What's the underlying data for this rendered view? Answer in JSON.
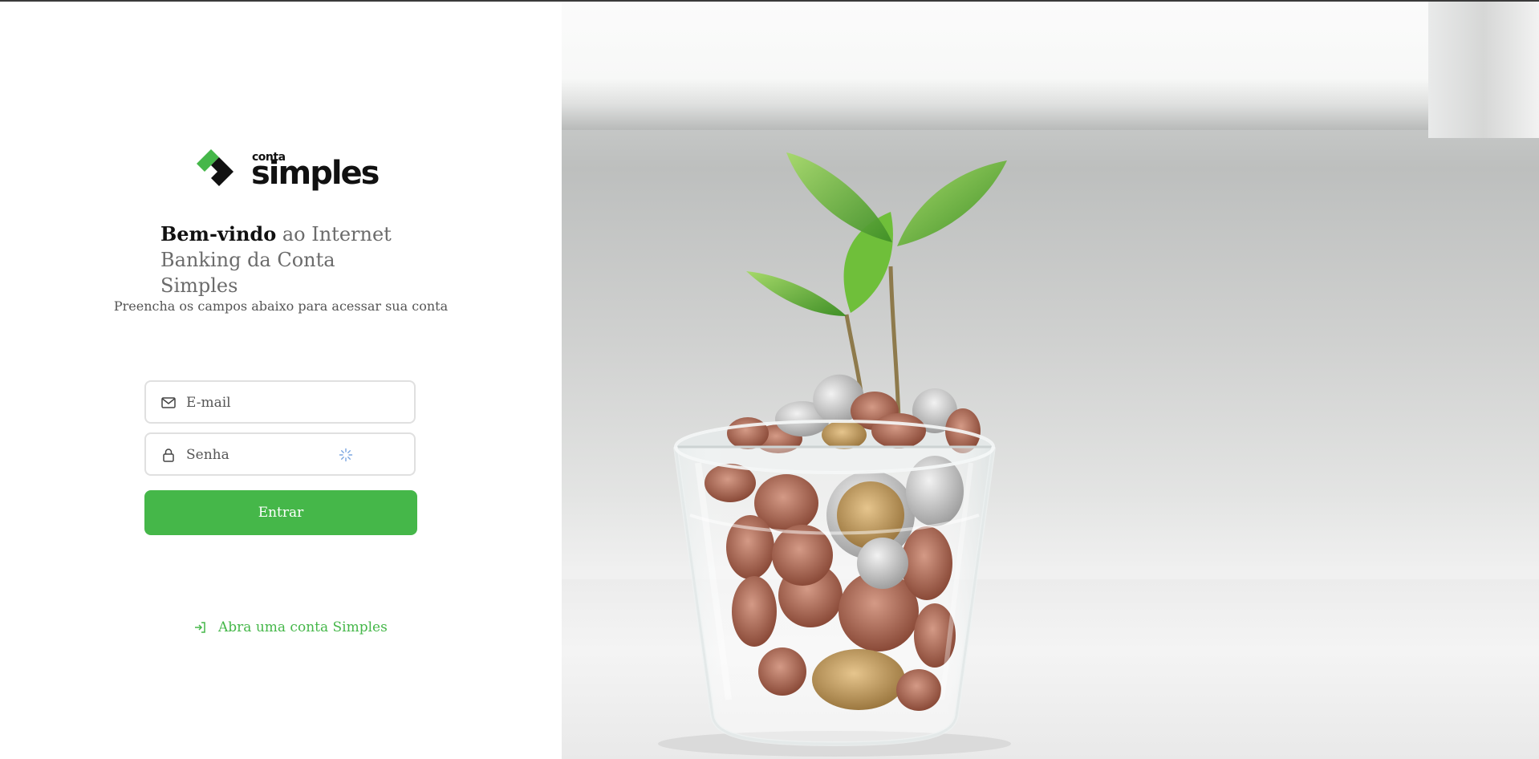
{
  "brand": {
    "small_word": "conta",
    "large_word": "simples",
    "colors": {
      "primary_green": "#45b749",
      "dark": "#111111"
    }
  },
  "welcome": {
    "strong": "Bem-vindo",
    "rest": " ao Internet Banking da Conta Simples"
  },
  "subtitle": "Preencha os campos abaixo para acessar sua conta",
  "form": {
    "email": {
      "placeholder": "E-mail",
      "icon": "mail-icon"
    },
    "senha": {
      "placeholder": "Senha",
      "icon": "lock-icon",
      "status_icon": "loading-spinner-icon"
    },
    "submit_label": "Entrar"
  },
  "open_account": {
    "label": "Abra uma conta Simples",
    "icon": "sign-in-arrow-icon"
  }
}
